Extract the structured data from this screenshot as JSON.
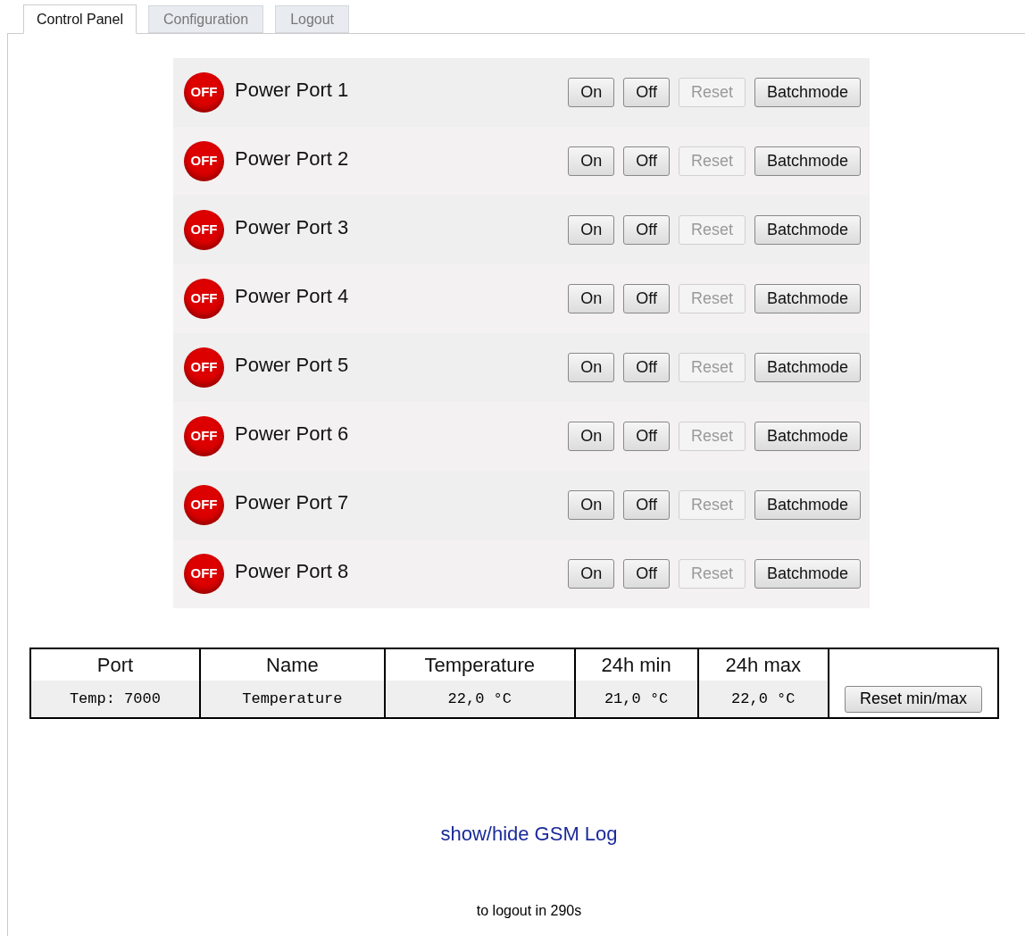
{
  "tabs": [
    {
      "label": "Control Panel",
      "selected": true
    },
    {
      "label": "Configuration",
      "selected": false
    },
    {
      "label": "Logout",
      "selected": false
    }
  ],
  "ports": [
    {
      "status": "OFF",
      "on": false,
      "name": "Power Port 1",
      "buttons": [
        {
          "label": "On",
          "disabled": false
        },
        {
          "label": "Off",
          "disabled": false
        },
        {
          "label": "Reset",
          "disabled": true
        },
        {
          "label": "Batchmode",
          "disabled": false
        }
      ]
    },
    {
      "status": "OFF",
      "on": false,
      "name": "Power Port 2",
      "buttons": [
        {
          "label": "On",
          "disabled": false
        },
        {
          "label": "Off",
          "disabled": false
        },
        {
          "label": "Reset",
          "disabled": true
        },
        {
          "label": "Batchmode",
          "disabled": false
        }
      ]
    },
    {
      "status": "OFF",
      "on": false,
      "name": "Power Port 3",
      "buttons": [
        {
          "label": "On",
          "disabled": false
        },
        {
          "label": "Off",
          "disabled": false
        },
        {
          "label": "Reset",
          "disabled": true
        },
        {
          "label": "Batchmode",
          "disabled": false
        }
      ]
    },
    {
      "status": "OFF",
      "on": false,
      "name": "Power Port 4",
      "buttons": [
        {
          "label": "On",
          "disabled": false
        },
        {
          "label": "Off",
          "disabled": false
        },
        {
          "label": "Reset",
          "disabled": true
        },
        {
          "label": "Batchmode",
          "disabled": false
        }
      ]
    },
    {
      "status": "OFF",
      "on": false,
      "name": "Power Port 5",
      "buttons": [
        {
          "label": "On",
          "disabled": false
        },
        {
          "label": "Off",
          "disabled": false
        },
        {
          "label": "Reset",
          "disabled": true
        },
        {
          "label": "Batchmode",
          "disabled": false
        }
      ]
    },
    {
      "status": "OFF",
      "on": false,
      "name": "Power Port 6",
      "buttons": [
        {
          "label": "On",
          "disabled": false
        },
        {
          "label": "Off",
          "disabled": false
        },
        {
          "label": "Reset",
          "disabled": true
        },
        {
          "label": "Batchmode",
          "disabled": false
        }
      ]
    },
    {
      "status": "OFF",
      "on": false,
      "name": "Power Port 7",
      "buttons": [
        {
          "label": "On",
          "disabled": false
        },
        {
          "label": "Off",
          "disabled": false
        },
        {
          "label": "Reset",
          "disabled": true
        },
        {
          "label": "Batchmode",
          "disabled": false
        }
      ]
    },
    {
      "status": "OFF",
      "on": false,
      "name": "Power Port 8",
      "buttons": [
        {
          "label": "On",
          "disabled": false
        },
        {
          "label": "Off",
          "disabled": false
        },
        {
          "label": "Reset",
          "disabled": true
        },
        {
          "label": "Batchmode",
          "disabled": false
        }
      ]
    }
  ],
  "sensor_table": {
    "columns": [
      "Port",
      "Name",
      "Temperature",
      "24h min",
      "24h max"
    ],
    "rows": [
      {
        "cells": [
          "Temp: 7000",
          "Temperature",
          "22,0 °C",
          "21,0 °C",
          "22,0 °C"
        ],
        "button": "Reset min/max"
      }
    ]
  },
  "gsm_log_link": "show/hide GSM Log",
  "logout_timer": "to logout in 290s"
}
